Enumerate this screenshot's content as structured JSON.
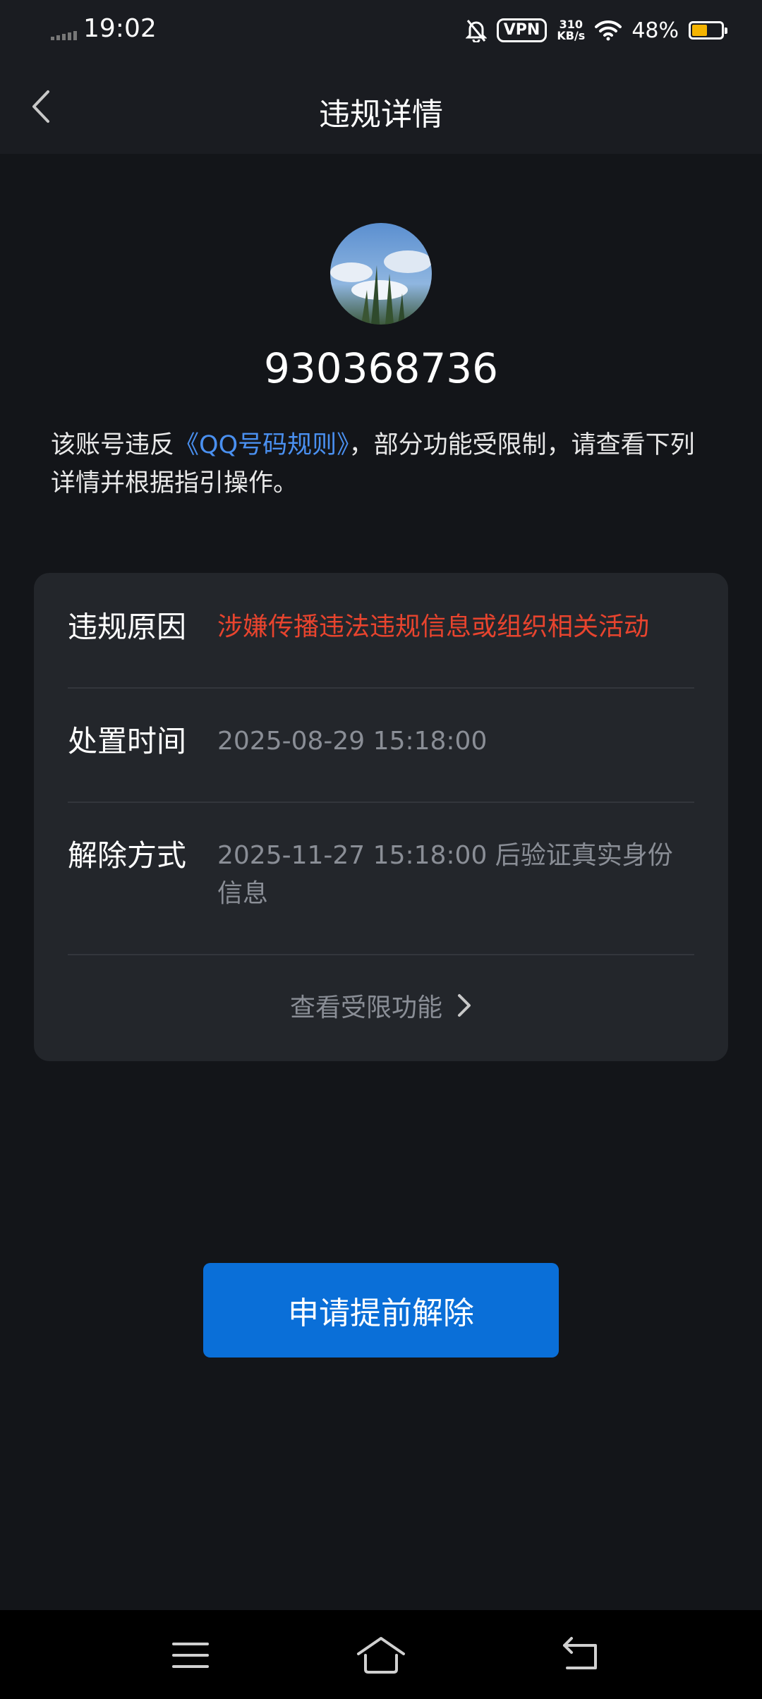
{
  "status_bar": {
    "time": "19:02",
    "vpn": "VPN",
    "speed_value": "310",
    "speed_unit": "KB/s",
    "battery": "48%",
    "battery_level": 0.48
  },
  "nav": {
    "title": "违规详情",
    "back_icon": "chevron-left-icon"
  },
  "account": {
    "id": "930368736"
  },
  "notice": {
    "prefix": "该账号违反",
    "link": "《QQ号码规则》",
    "suffix": "，部分功能受限制，请查看下列详情并根据指引操作。"
  },
  "details": {
    "reason_label": "违规原因",
    "reason_value": "涉嫌传播违法违规信息或组织相关活动",
    "time_label": "处置时间",
    "time_value": "2025-08-29 15:18:00",
    "release_label": "解除方式",
    "release_value": "2025-11-27 15:18:00 后验证真实身份信息",
    "view_restricted": "查看受限功能"
  },
  "actions": {
    "apply_label": "申请提前解除"
  },
  "colors": {
    "background": "#131519",
    "card": "#23262b",
    "link": "#4a90f0",
    "warning": "#e8442e",
    "primary_button": "#0a6fd8"
  }
}
